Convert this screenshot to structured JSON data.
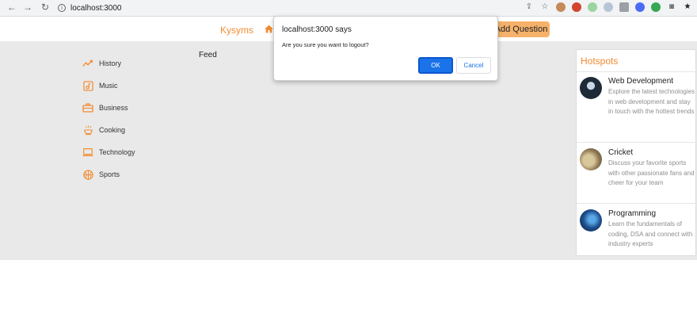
{
  "browser": {
    "url": "localhost:3000",
    "info_icon": "i"
  },
  "header": {
    "brand": "Kysyms",
    "add_question": "Add Question"
  },
  "sidebar": {
    "items": [
      {
        "label": "History",
        "icon": "trend-icon"
      },
      {
        "label": "Music",
        "icon": "music-icon"
      },
      {
        "label": "Business",
        "icon": "briefcase-icon"
      },
      {
        "label": "Cooking",
        "icon": "cooking-icon"
      },
      {
        "label": "Technology",
        "icon": "laptop-icon"
      },
      {
        "label": "Sports",
        "icon": "basketball-icon"
      }
    ]
  },
  "feed": {
    "label": "Feed"
  },
  "hotspots": {
    "title": "Hotspots",
    "items": [
      {
        "name": "Web Development",
        "desc": "Explore the latest technologies in web development and stay in touch with the hottest trends"
      },
      {
        "name": "Cricket",
        "desc": "Discuss your favorite sports with other passionate fans and cheer for your team"
      },
      {
        "name": "Programming",
        "desc": "Learn the fundamentals of coding, DSA and connect with industry experts"
      }
    ]
  },
  "dialog": {
    "title": "localhost:3000 says",
    "message": "Are you sure you want to logout?",
    "ok": "OK",
    "cancel": "Cancel"
  },
  "colors": {
    "accent": "#f28b30",
    "button_bg": "#f6b26b",
    "dialog_primary": "#1a73e8"
  }
}
